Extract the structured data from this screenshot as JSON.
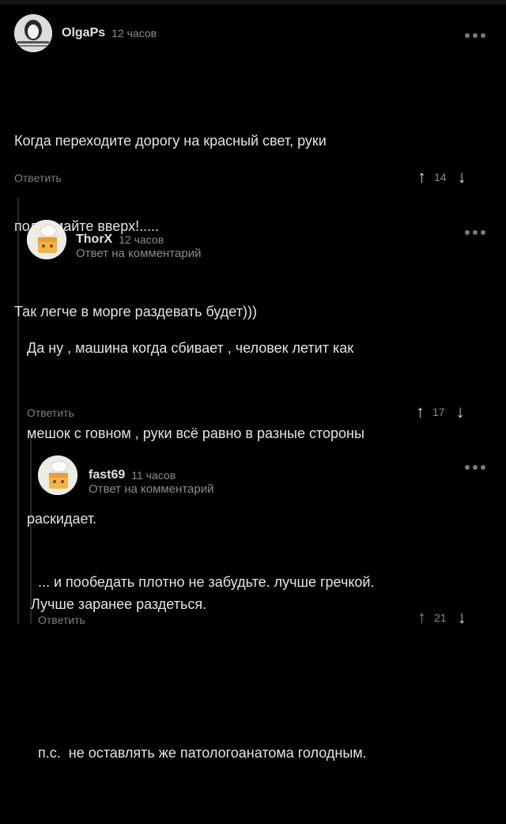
{
  "comments": [
    {
      "author": "OlgaPs",
      "time": "12 часов",
      "reply_to": "",
      "text_lines": [
        "Когда переходите дорогу на красный свет, руки",
        "поднимайте вверх!.....",
        "Так легче в морге раздевать будет)))"
      ],
      "reply_label": "Ответить",
      "score": "14",
      "upvoted": false
    },
    {
      "author": "ThorX",
      "time": "12 часов",
      "reply_to": "Ответ на комментарий",
      "text_lines": [
        "Да ну , машина когда сбивает , человек летит как",
        "мешок с говном , руки всё равно в разные стороны",
        "раскидает.",
        " Лучше заранее раздеться."
      ],
      "reply_label": "Ответить",
      "score": "17",
      "upvoted": false
    },
    {
      "author": "fast69",
      "time": "11 часов",
      "reply_to": "Ответ на комментарий",
      "text_lines": [
        "... и пообедать плотно не забудьте. лучше гречкой.",
        "",
        "п.с.  не оставлять же патологоанатома голодным."
      ],
      "reply_label": "Ответить",
      "score": "21",
      "upvoted": true
    }
  ],
  "icons": {
    "more": "more-icon",
    "upvote": "arrow-up-icon",
    "downvote": "arrow-down-icon"
  },
  "colors": {
    "background": "#000000",
    "upvote_active": "#2fb05a"
  }
}
